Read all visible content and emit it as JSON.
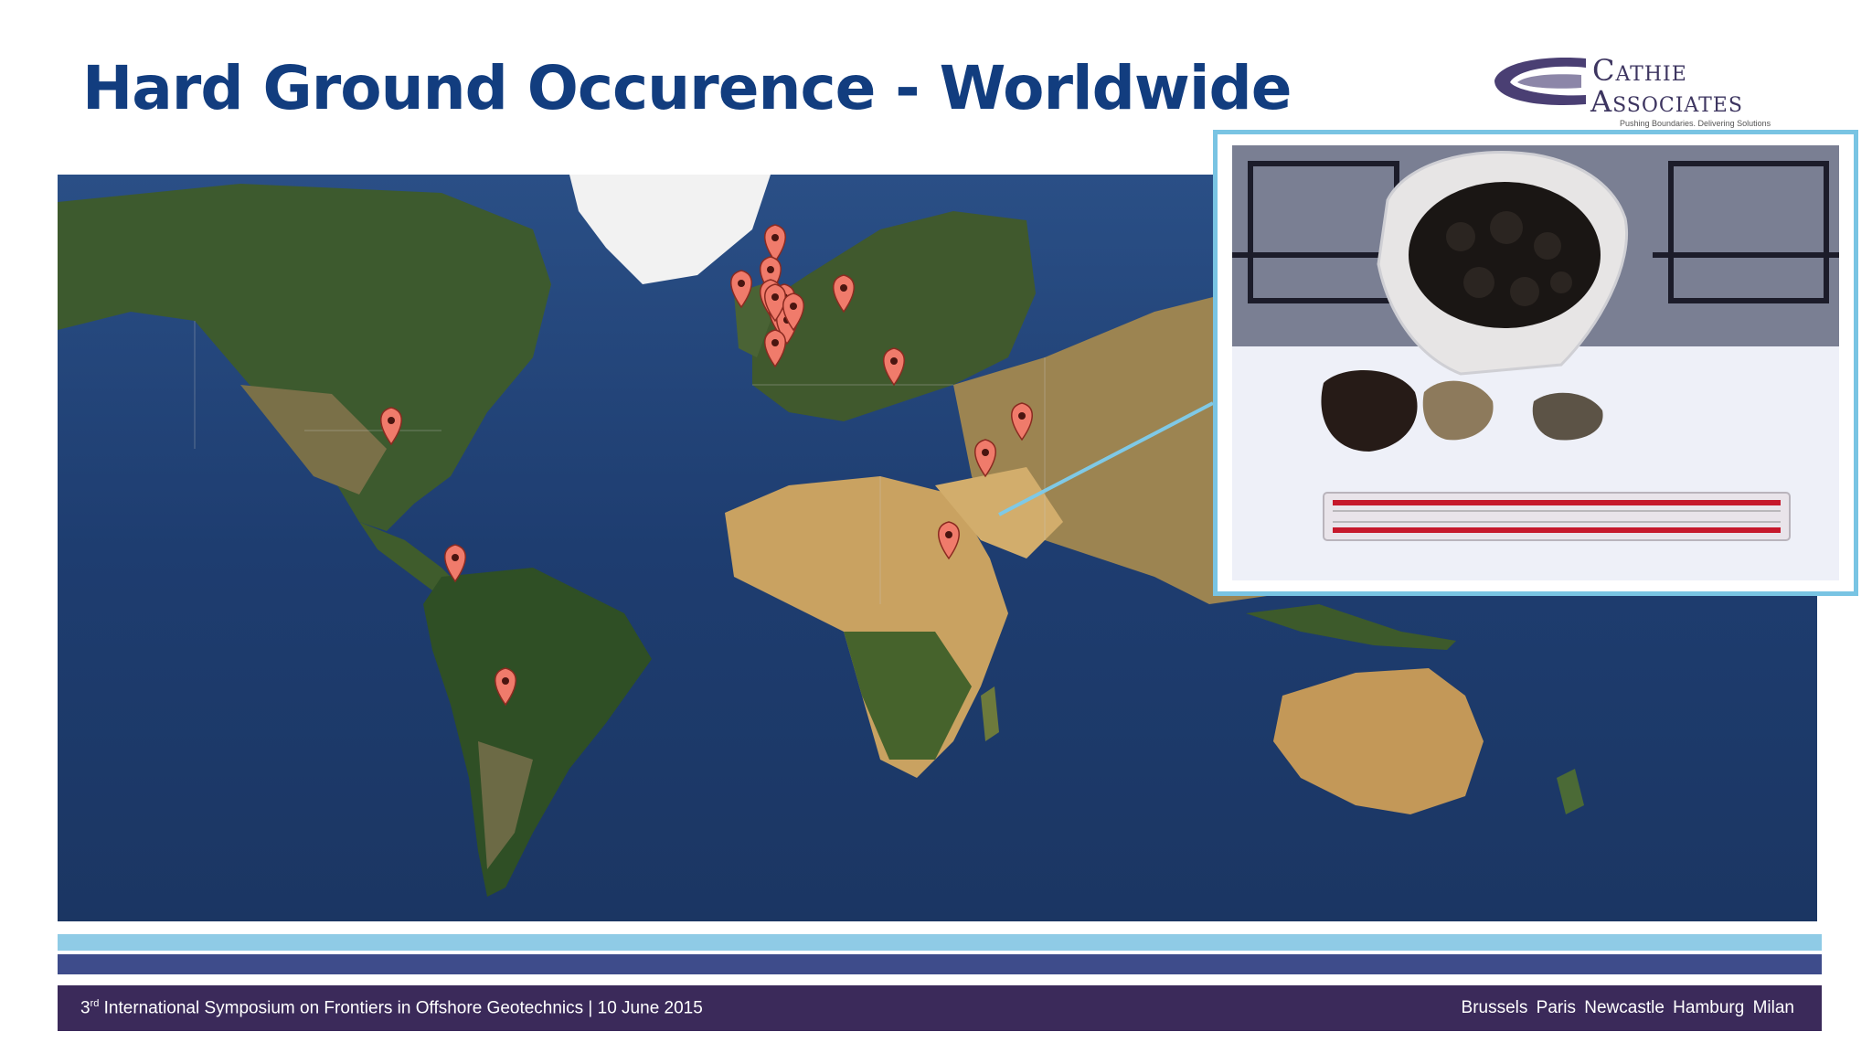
{
  "title": "Hard Ground Occurence - Worldwide",
  "logo": {
    "line1": "Cathie",
    "line2": "Associates",
    "tagline": "Pushing Boundaries. Delivering Solutions"
  },
  "map": {
    "marker_color": "#f07b6b",
    "marker_count": 19,
    "marker_icon": "map-pin-icon"
  },
  "photo": {
    "subject": "rock-samples-photo",
    "border_color": "#79c4e3"
  },
  "footer": {
    "event_ordinal": "3",
    "event_suffix": "rd",
    "event_rest": " International Symposium on Frontiers in Offshore Geotechnics | 10 June 2015",
    "cities": "Brussels  Paris  Newcastle  Hamburg  Milan"
  },
  "colors": {
    "title": "#123d7f",
    "footer_bar": "#3b2a5a",
    "band_light": "#8fcbe6",
    "band_dark": "#3e4c8b"
  }
}
